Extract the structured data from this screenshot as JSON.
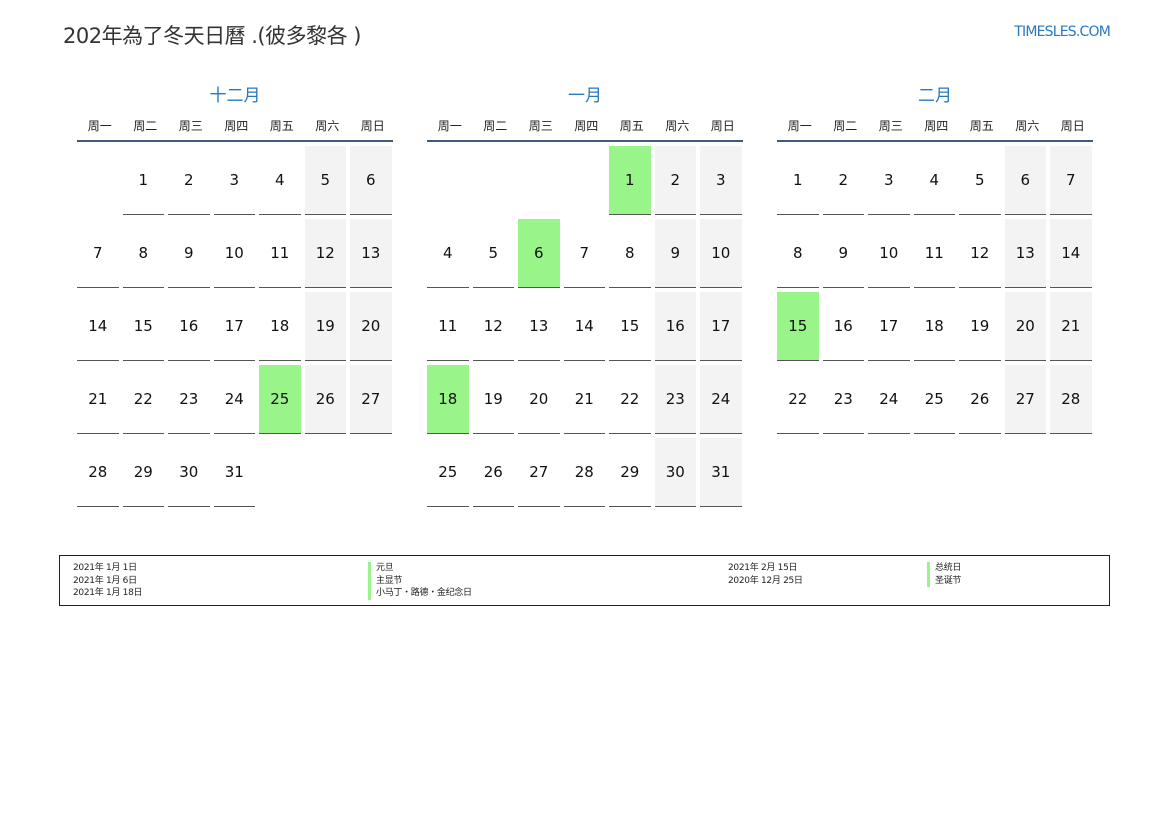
{
  "header": {
    "title": "202年為了冬天日曆 .(彼多黎各 )",
    "site": "TIMESLES.COM"
  },
  "weekdays": [
    "周一",
    "周二",
    "周三",
    "周四",
    "周五",
    "周六",
    "周日"
  ],
  "months": [
    {
      "name": "十二月",
      "cells": [
        "",
        "1",
        "2",
        "3",
        "4",
        "5",
        "6",
        "7",
        "8",
        "9",
        "10",
        "11",
        "12",
        "13",
        "14",
        "15",
        "16",
        "17",
        "18",
        "19",
        "20",
        "21",
        "22",
        "23",
        "24",
        "25",
        "26",
        "27",
        "28",
        "29",
        "30",
        "31",
        "",
        "",
        "",
        ""
      ],
      "holidays": [
        "25"
      ]
    },
    {
      "name": "一月",
      "cells": [
        "",
        "",
        "",
        "",
        "1",
        "2",
        "3",
        "4",
        "5",
        "6",
        "7",
        "8",
        "9",
        "10",
        "11",
        "12",
        "13",
        "14",
        "15",
        "16",
        "17",
        "18",
        "19",
        "20",
        "21",
        "22",
        "23",
        "24",
        "25",
        "26",
        "27",
        "28",
        "29",
        "30",
        "31"
      ],
      "holidays": [
        "1",
        "6",
        "18"
      ]
    },
    {
      "name": "二月",
      "cells": [
        "1",
        "2",
        "3",
        "4",
        "5",
        "6",
        "7",
        "8",
        "9",
        "10",
        "11",
        "12",
        "13",
        "14",
        "15",
        "16",
        "17",
        "18",
        "19",
        "20",
        "21",
        "22",
        "23",
        "24",
        "25",
        "26",
        "27",
        "28"
      ],
      "holidays": [
        "15"
      ]
    }
  ],
  "legend": {
    "left_dates": [
      "2021年 1月 1日",
      "2021年 1月 6日",
      "2021年 1月 18日"
    ],
    "left_names": [
      "元旦",
      "主显节",
      "小马丁・路德・金纪念日"
    ],
    "right_dates": [
      "2021年 2月 15日",
      "2020年 12月 25日"
    ],
    "right_names": [
      "总统日",
      "圣诞节"
    ]
  },
  "colors": {
    "accent": "#2878c0",
    "holiday": "#99f58a",
    "weekend": "#f3f3f3"
  }
}
